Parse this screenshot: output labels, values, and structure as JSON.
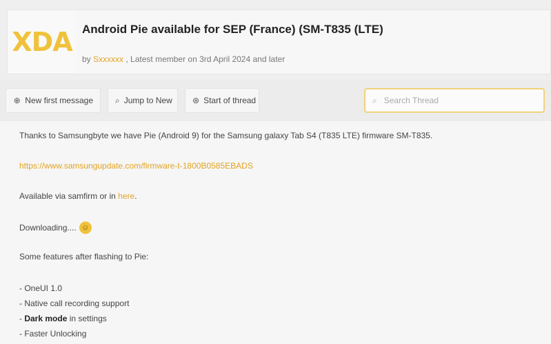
{
  "header": {
    "logo_text": "XDA",
    "title": "Android Pie available for SEP (France) (SM-T835 (LTE)",
    "meta_prefix": "by",
    "author": "Sxxxxxx",
    "meta_suffix": ", Latest member on 3rd April 2024 and later"
  },
  "toolbar": {
    "new_message": "New first message",
    "unread": "Jump to New",
    "first_unread": "Start of thread",
    "search_placeholder": "Search Thread"
  },
  "post": {
    "line1": "Thanks to Samsungbyte we have Pie (Android 9) for the Samsung galaxy Tab S4 (T835 LTE) firmware SM-T835.",
    "link_line": "https://www.samsungupdate.com/firmware-t-1800B0585EBADS",
    "line3_prefix": "Available via samfirm or in ",
    "line3_link": "here",
    "line3_suffix": ".",
    "line4": "Downloading....",
    "smiley": "☺",
    "line5": "Some features after flashing to Pie:",
    "features": [
      "- OneUI 1.0",
      "- Native call recording support",
      "- Dark mode in settings",
      "- Faster Unlocking"
    ],
    "feature_bold_word": "Dark mode"
  },
  "icons": {
    "new_message_icon": "plus-circle-icon",
    "unread_icon": "search-icon",
    "first_unread_icon": "arrow-circle-icon",
    "search_icon": "search-icon"
  },
  "colors": {
    "accent": "#f0c23b",
    "link": "#e3a320"
  }
}
